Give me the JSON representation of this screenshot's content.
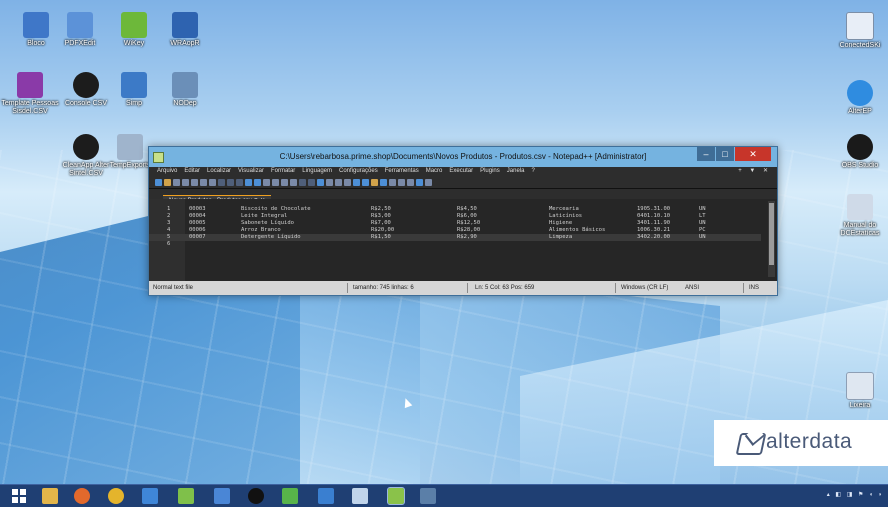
{
  "desktop_icons": [
    {
      "label": "Bloco"
    },
    {
      "label": "PDFXEdit"
    },
    {
      "label": "WiKey"
    },
    {
      "label": "WRAopR"
    },
    {
      "label": "Template Pessoas Sisdel.CSV"
    },
    {
      "label": "Console CSV"
    },
    {
      "label": "Simp"
    },
    {
      "label": "NODep"
    },
    {
      "label": "CleanApp Alter Sintel.CSV"
    },
    {
      "label": "TempExports"
    },
    {
      "label": "ConectedSKi"
    },
    {
      "label": "AlterEP"
    },
    {
      "label": "OBS Studio"
    },
    {
      "label": "Manual do DCEstatícas"
    },
    {
      "label": "Lixeira"
    }
  ],
  "window": {
    "title": "C:\\Users\\rebarbosa.prime.shop\\Documents\\Novos Produtos - Produtos.csv - Notepad++ [Administrator]",
    "buttons": {
      "min": "–",
      "max": "□",
      "close": "✕"
    }
  },
  "menu": [
    "Arquivo",
    "Editar",
    "Localizar",
    "Visualizar",
    "Formatar",
    "Linguagem",
    "Configurações",
    "Ferramentas",
    "Macro",
    "Executar",
    "Plugins",
    "Janela",
    "?"
  ],
  "menu_controls": "+ ▼ ✕",
  "tab": {
    "label": "Novos Produtos - Produtos.csv  ⊘  ✕"
  },
  "editor": {
    "line_numbers": [
      "1",
      "2",
      "3",
      "4",
      "5",
      "6"
    ],
    "rows": [
      {
        "code": "00003",
        "name": "Biscoito de Chocolate",
        "cost": "R$2,50",
        "price": "R$4,50",
        "category": "Mercearia",
        "ncm": "1905.31.00",
        "unit": "UN"
      },
      {
        "code": "00004",
        "name": "Leite Integral",
        "cost": "R$3,00",
        "price": "R$6,00",
        "category": "Laticínios",
        "ncm": "0401.10.10",
        "unit": "LT"
      },
      {
        "code": "00005",
        "name": "Sabonete Líquido",
        "cost": "R$7,00",
        "price": "R$12,50",
        "category": "Higiene",
        "ncm": "3401.11.90",
        "unit": "UN"
      },
      {
        "code": "00006",
        "name": "Arroz Branco",
        "cost": "R$20,00",
        "price": "R$28,00",
        "category": "Alimentos Básicos",
        "ncm": "1006.30.21",
        "unit": "PC"
      },
      {
        "code": "00007",
        "name": "Detergente Líquido",
        "cost": "R$1,50",
        "price": "R$2,90",
        "category": "Limpeza",
        "ncm": "3402.20.00",
        "unit": "UN"
      }
    ]
  },
  "statusbar": {
    "type": "Normal text file",
    "length": "tamanho: 745   linhas: 6",
    "pos": "Ln: 5   Col: 63   Pos: 659",
    "eol": "Windows (CR LF)",
    "enc": "ANSI",
    "ins": "INS"
  },
  "logo": {
    "text": "alterdata"
  },
  "taskbar": {
    "tray_text": "▴ ◧ ◨ ⚑ ◖ ◗"
  }
}
